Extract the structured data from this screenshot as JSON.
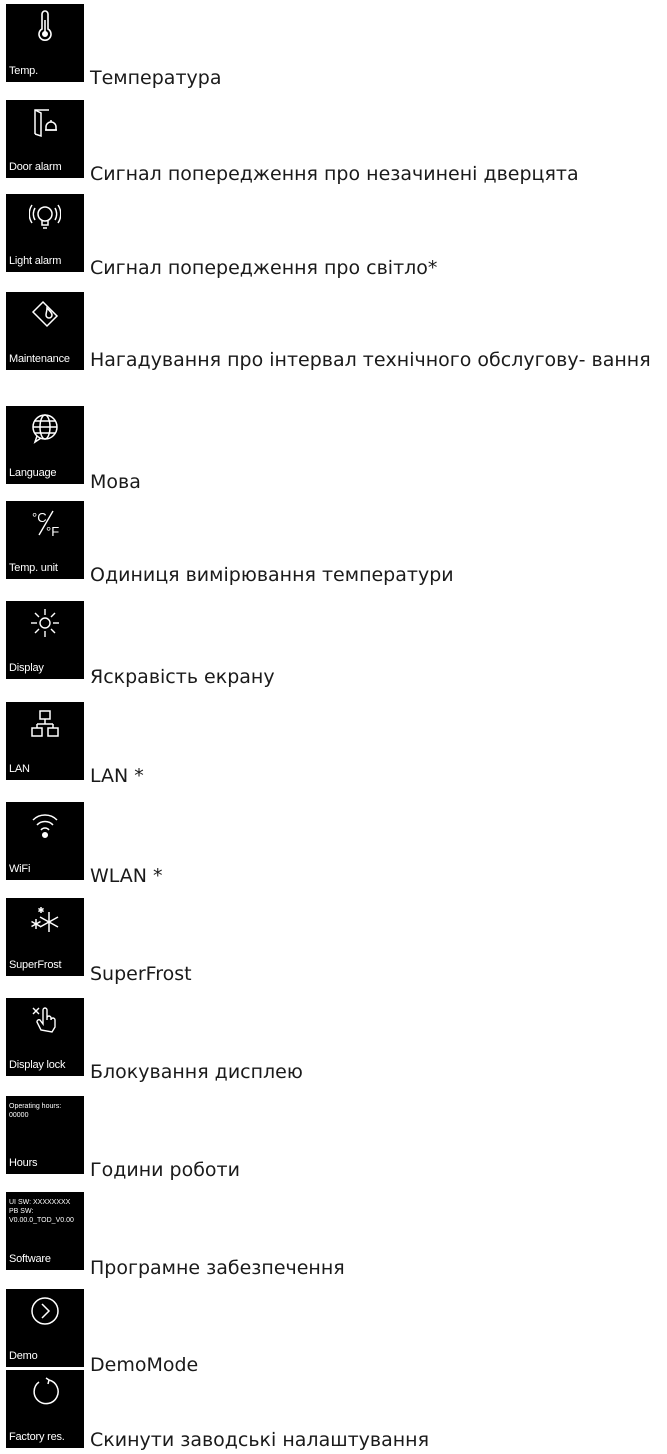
{
  "items": [
    {
      "caption": "Temp.",
      "label": "Температура",
      "icon": "thermometer-icon"
    },
    {
      "caption": "Door alarm",
      "label": "Сигнал попередження про незачинені дверцята",
      "icon": "door-bell-icon"
    },
    {
      "caption": "Light alarm",
      "label": "Сигнал попередження про світло*",
      "icon": "lightbulb-icon"
    },
    {
      "caption": "Maintenance",
      "label": "Нагадування про інтервал технічного обслугову- вання",
      "icon": "filter-drop-icon"
    },
    {
      "caption": "Language",
      "label": "Мова",
      "icon": "globe-icon"
    },
    {
      "caption": "Temp. unit",
      "label": "Одиниця вимірювання температури",
      "icon": "celsius-fahrenheit-icon"
    },
    {
      "caption": "Display",
      "label": "Яскравість екрану",
      "icon": "brightness-icon"
    },
    {
      "caption": "LAN",
      "label": "LAN *",
      "icon": "network-icon"
    },
    {
      "caption": "WiFi",
      "label": "WLAN *",
      "icon": "wifi-icon"
    },
    {
      "caption": "SuperFrost",
      "label": "SuperFrost",
      "icon": "snowflake-icon"
    },
    {
      "caption": "Display lock",
      "label": "Блокування дисплею",
      "icon": "touch-lock-icon"
    },
    {
      "caption": "Hours",
      "label": "Години роботи",
      "icon": "hours-text",
      "screen_text": "Operating hours:\n00000"
    },
    {
      "caption": "Software",
      "label": "Програмне забезпечення",
      "icon": "software-text",
      "screen_text": "UI SW: XXXXXXXX\nPB SW:\nV0.00.0_TOD_V0.00"
    },
    {
      "caption": "Demo",
      "label": "DemoMode",
      "icon": "play-circle-icon"
    },
    {
      "caption": "Factory res.",
      "label": "Скинути заводські налаштування",
      "icon": "reset-icon"
    }
  ]
}
